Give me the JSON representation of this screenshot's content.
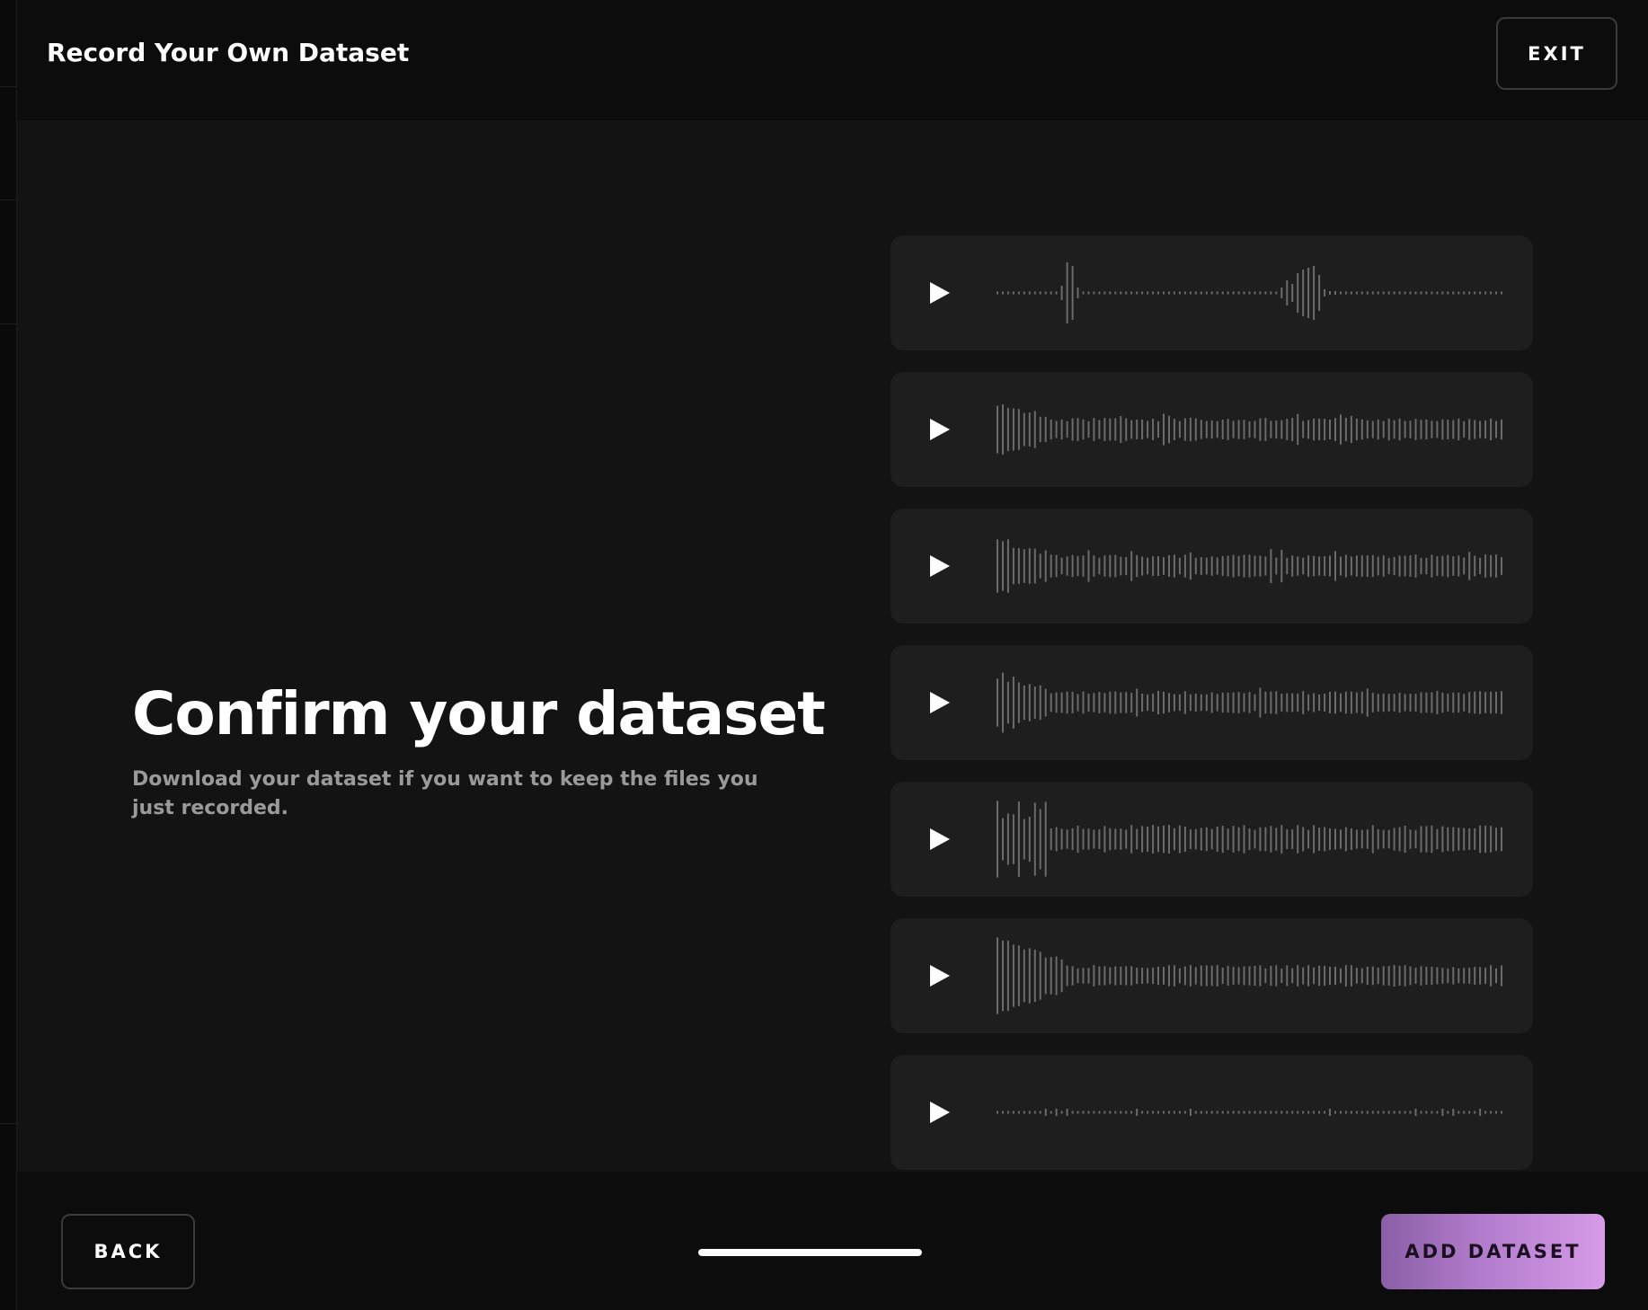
{
  "header": {
    "title": "Record Your Own Dataset",
    "exit_label": "EXIT"
  },
  "main": {
    "heading": "Confirm your dataset",
    "subtitle": "Download your dataset if you want to keep the files you just recorded."
  },
  "clips": [
    {
      "icon": "play-icon",
      "pattern": "sparse"
    },
    {
      "icon": "play-icon",
      "pattern": "dense"
    },
    {
      "icon": "play-icon",
      "pattern": "dense"
    },
    {
      "icon": "play-icon",
      "pattern": "dense"
    },
    {
      "icon": "play-icon",
      "pattern": "dense-peak"
    },
    {
      "icon": "play-icon",
      "pattern": "dense-decay"
    },
    {
      "icon": "play-icon",
      "pattern": "quiet"
    }
  ],
  "footer": {
    "back_label": "BACK",
    "progress_fraction": 1.0,
    "add_label": "ADD DATASET"
  },
  "colors": {
    "accent_start": "#8a5fa6",
    "accent_end": "#d69be8",
    "card_bg": "#1e1e1e",
    "wave": "#6b6b6b"
  }
}
